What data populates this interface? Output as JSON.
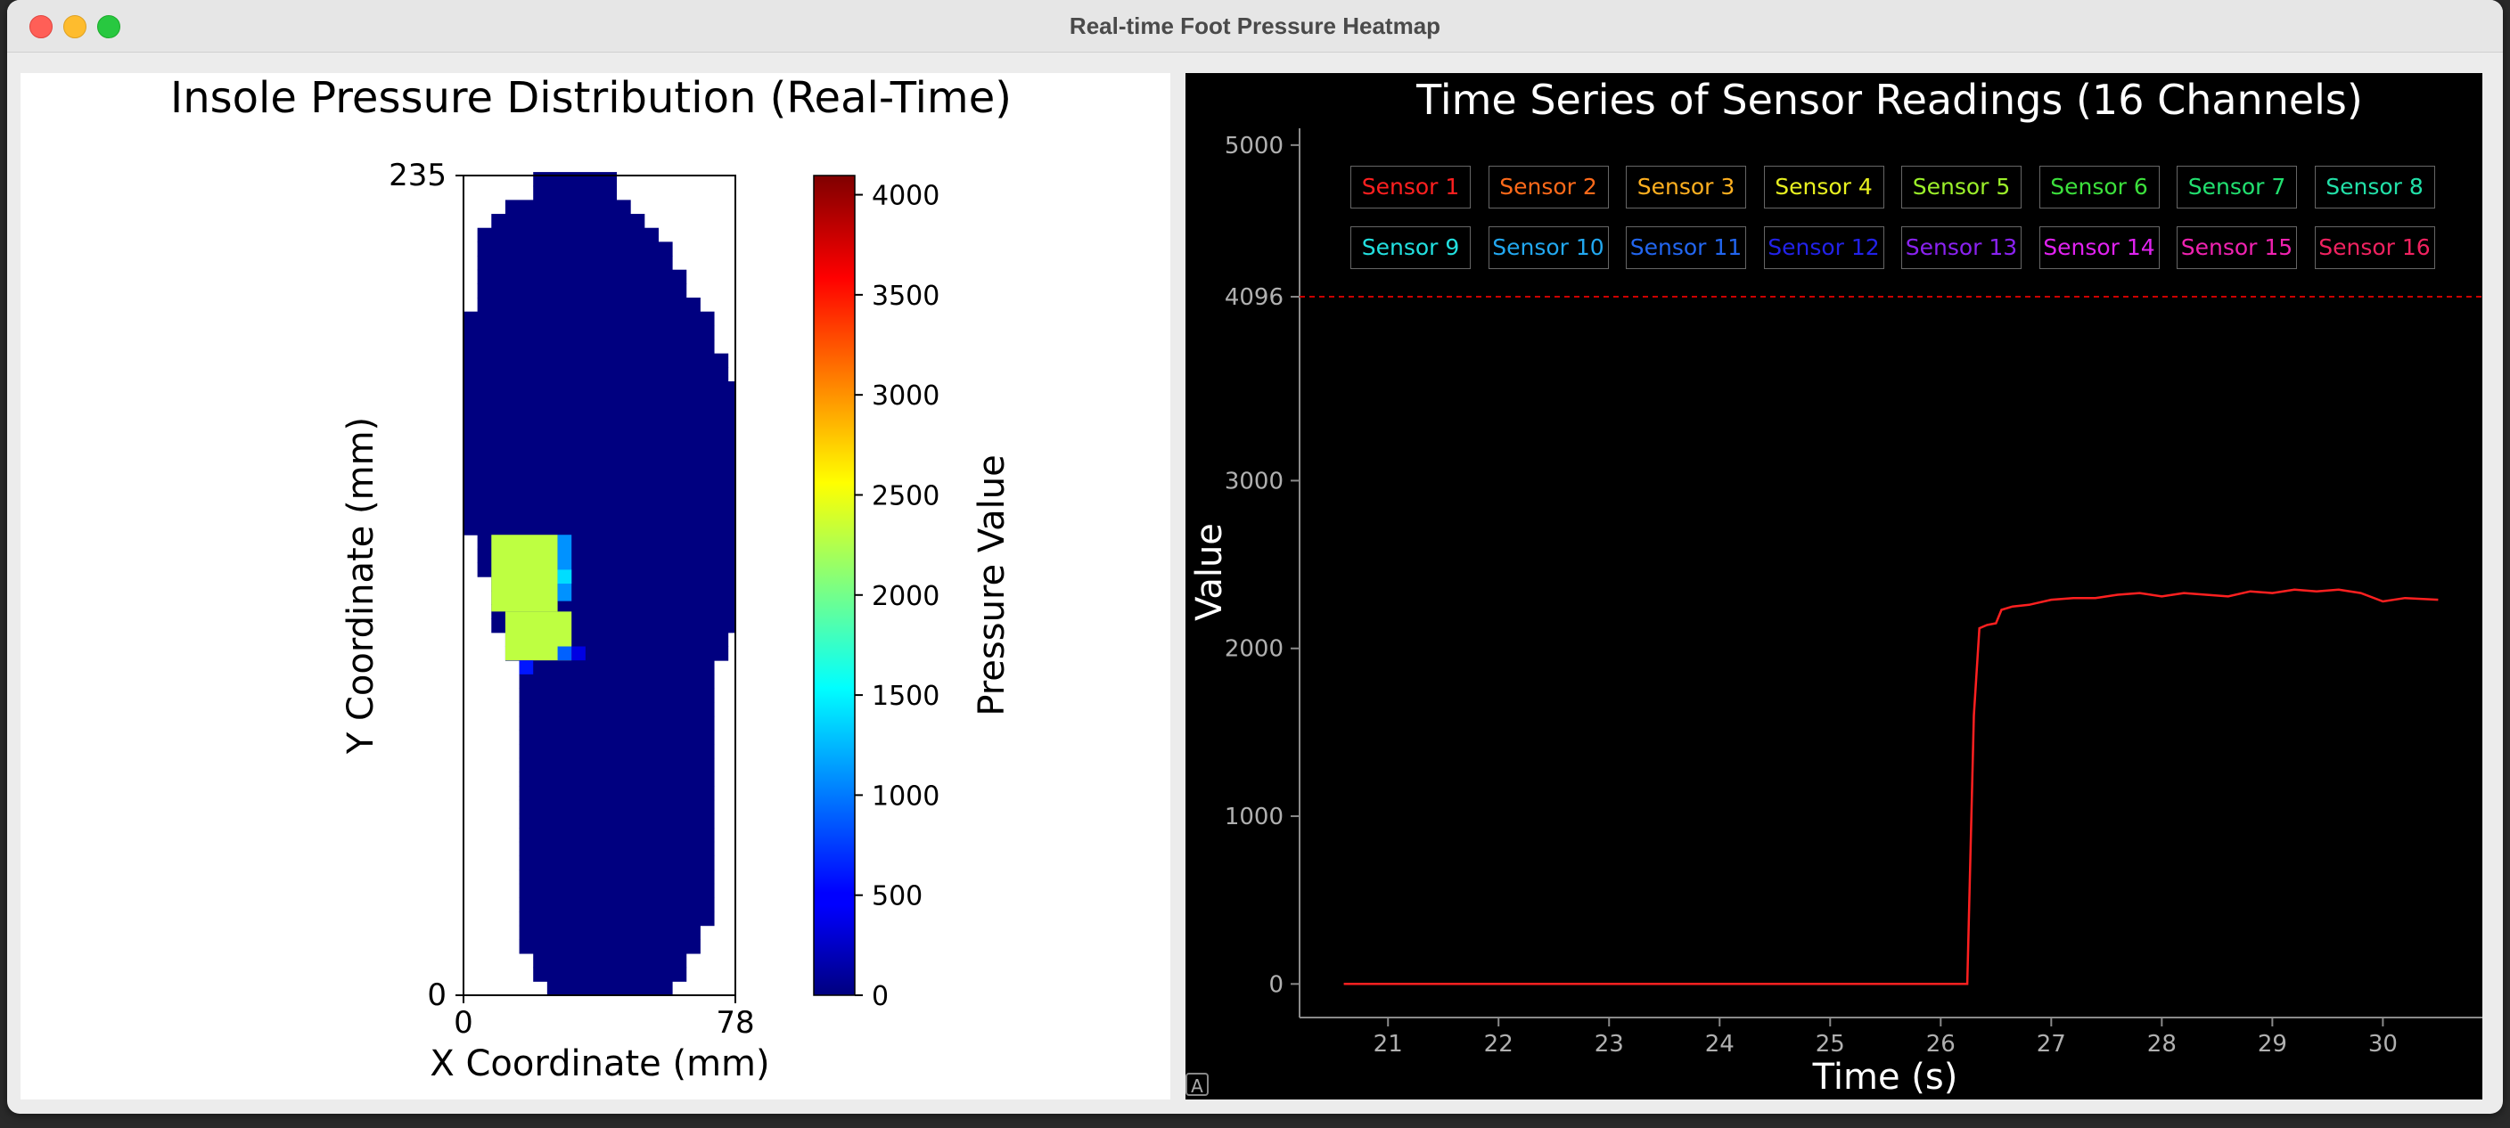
{
  "window": {
    "title": "Real-time Foot Pressure Heatmap"
  },
  "chart_data": [
    {
      "type": "heatmap",
      "title": "Insole Pressure Distribution (Real-Time)",
      "xlabel": "X Coordinate (mm)",
      "ylabel": "Y Coordinate (mm)",
      "xlim": [
        0,
        78
      ],
      "ylim": [
        0,
        235
      ],
      "x_ticks": [
        "0",
        "78"
      ],
      "y_ticks": [
        "0",
        "235"
      ],
      "colormap": "jet",
      "colorbar_label": "Pressure Value",
      "colorbar_range": [
        0,
        4096
      ],
      "colorbar_ticks": [
        "0",
        "500",
        "1000",
        "1500",
        "2000",
        "2500",
        "3000",
        "3500",
        "4000"
      ],
      "background_value": 0,
      "regions": [
        {
          "x": [
            8,
            27
          ],
          "y": [
            110,
            132
          ],
          "value": 2300
        },
        {
          "x": [
            12,
            31
          ],
          "y": [
            96,
            110
          ],
          "value": 2300
        },
        {
          "x": [
            27,
            31
          ],
          "y": [
            113,
            132
          ],
          "value": 1100
        },
        {
          "x": [
            27,
            31
          ],
          "y": [
            118,
            122
          ],
          "value": 1400
        },
        {
          "x": [
            27,
            31
          ],
          "y": [
            96,
            100
          ],
          "value": 900
        },
        {
          "x": [
            16,
            20
          ],
          "y": [
            92,
            96
          ],
          "value": 600
        },
        {
          "x": [
            31,
            35
          ],
          "y": [
            96,
            100
          ],
          "value": 400
        }
      ]
    },
    {
      "type": "line",
      "title": "Time Series of Sensor Readings (16 Channels)",
      "xlabel": "Time (s)",
      "ylabel": "Value",
      "xlim": [
        20.2,
        30.9
      ],
      "ylim": [
        -200,
        5100
      ],
      "x_ticks": [
        "21",
        "22",
        "23",
        "24",
        "25",
        "26",
        "27",
        "28",
        "29",
        "30"
      ],
      "y_ticks": [
        "0",
        "1000",
        "2000",
        "3000",
        "4096",
        "5000"
      ],
      "reference_line": {
        "value": 4096,
        "style": "dashed",
        "color": "#cc0000"
      },
      "legend_position": "top",
      "series": [
        {
          "name": "Sensor 1",
          "color": "#ff2020",
          "x": [
            20.6,
            26.24,
            26.3,
            26.35,
            26.42,
            26.5,
            26.55,
            26.65,
            26.8,
            27.0,
            27.2,
            27.4,
            27.6,
            27.8,
            28.0,
            28.2,
            28.4,
            28.6,
            28.8,
            29.0,
            29.2,
            29.4,
            29.6,
            29.8,
            30.0,
            30.2,
            30.5
          ],
          "y": [
            0,
            0,
            1600,
            2120,
            2140,
            2150,
            2230,
            2250,
            2260,
            2290,
            2300,
            2300,
            2320,
            2330,
            2310,
            2330,
            2320,
            2310,
            2340,
            2330,
            2350,
            2340,
            2350,
            2330,
            2280,
            2300,
            2290
          ]
        },
        {
          "name": "Sensor 2",
          "color": "#ff6a1a"
        },
        {
          "name": "Sensor 3",
          "color": "#ffb020"
        },
        {
          "name": "Sensor 4",
          "color": "#e8f020"
        },
        {
          "name": "Sensor 5",
          "color": "#9cf02a"
        },
        {
          "name": "Sensor 6",
          "color": "#3ce03c"
        },
        {
          "name": "Sensor 7",
          "color": "#22e070"
        },
        {
          "name": "Sensor 8",
          "color": "#22e0a8"
        },
        {
          "name": "Sensor 9",
          "color": "#22e0e0"
        },
        {
          "name": "Sensor 10",
          "color": "#22a8f0"
        },
        {
          "name": "Sensor 11",
          "color": "#2266f0"
        },
        {
          "name": "Sensor 12",
          "color": "#2222e8"
        },
        {
          "name": "Sensor 13",
          "color": "#8a22f0"
        },
        {
          "name": "Sensor 14",
          "color": "#e022f0"
        },
        {
          "name": "Sensor 15",
          "color": "#f022b0"
        },
        {
          "name": "Sensor 16",
          "color": "#f02260"
        }
      ]
    }
  ]
}
